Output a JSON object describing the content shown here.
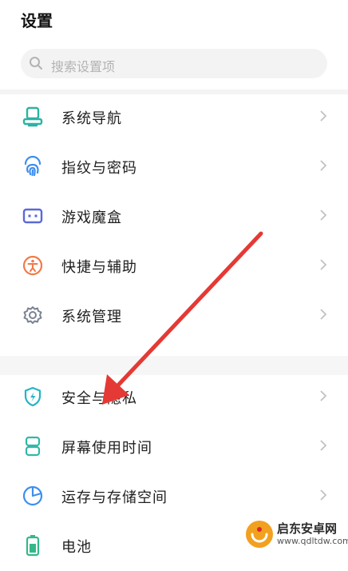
{
  "header": {
    "title": "设置"
  },
  "search": {
    "placeholder": "搜索设置项"
  },
  "settings": {
    "items": [
      {
        "label": "系统导航",
        "icon": "navigation-icon",
        "color": "#2bb3a3"
      },
      {
        "label": "指纹与密码",
        "icon": "fingerprint-icon",
        "color": "#3d8ef0"
      },
      {
        "label": "游戏魔盒",
        "icon": "gamepad-icon",
        "color": "#5b69d6"
      },
      {
        "label": "快捷与辅助",
        "icon": "accessibility-icon",
        "color": "#f07a48"
      },
      {
        "label": "系统管理",
        "icon": "gear-icon",
        "color": "#7a8394"
      },
      {
        "label": "安全与隐私",
        "icon": "shield-icon",
        "color": "#23b4c4"
      },
      {
        "label": "屏幕使用时间",
        "icon": "hourglass-icon",
        "color": "#31b8a8"
      },
      {
        "label": "运存与存储空间",
        "icon": "pie-chart-icon",
        "color": "#3d8ef0"
      },
      {
        "label": "电池",
        "icon": "battery-icon",
        "color": "#34b889"
      }
    ]
  },
  "watermark": {
    "title": "启东安卓网",
    "url": "www.qdltdw.com"
  },
  "colors": {
    "arrow": "#e53935",
    "chevron": "#c2c2c2",
    "search_bg": "#f3f3f3"
  }
}
